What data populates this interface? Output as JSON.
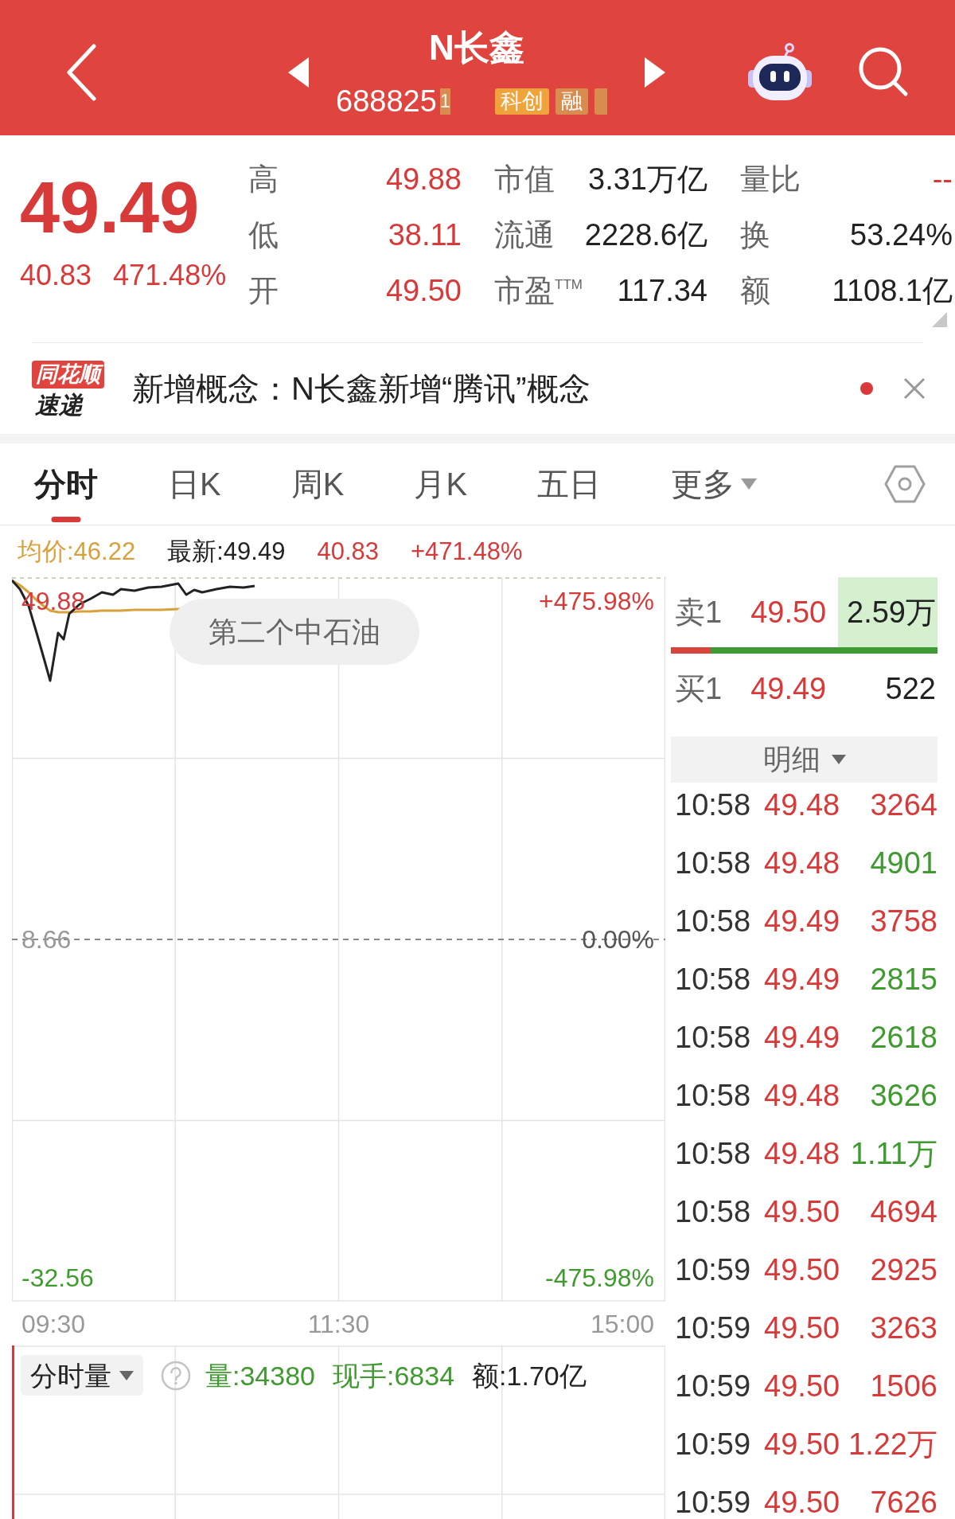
{
  "header": {
    "title": "N长鑫",
    "code": "688825",
    "tags": [
      {
        "kind": "partial",
        "text": "1",
        "color": "#d98c4f"
      },
      {
        "kind": "chip",
        "text": "科创",
        "color": "#f0a33b"
      },
      {
        "kind": "chip",
        "text": "融",
        "color": "#d98c4f"
      },
      {
        "kind": "clipped",
        "color": "#d98c4f"
      }
    ]
  },
  "quote": {
    "price": "49.49",
    "change": "40.83",
    "change_percent": "471.48%",
    "stat_rows": [
      {
        "cells": [
          {
            "label": "高",
            "value": "49.88",
            "color": "#d83a3a"
          },
          {
            "label": "市值",
            "value": "3.31万亿",
            "color": "#222222"
          },
          {
            "label": "量比",
            "value": "--",
            "color": "#d83a3a"
          }
        ]
      },
      {
        "cells": [
          {
            "label": "低",
            "value": "38.11",
            "color": "#d83a3a"
          },
          {
            "label": "流通",
            "value": "2228.6亿",
            "color": "#222222"
          },
          {
            "label": "换",
            "value": "53.24%",
            "color": "#222222"
          }
        ]
      },
      {
        "cells": [
          {
            "label": "开",
            "value": "49.50",
            "color": "#d83a3a"
          },
          {
            "label": "市盈$^{TTM}$",
            "value": "117.34",
            "color": "#222222"
          },
          {
            "label": "额",
            "value": "1108.1亿",
            "color": "#222222"
          }
        ]
      }
    ]
  },
  "news": {
    "logo_tag": "同花顺",
    "logo_text": "速递",
    "text": "新增概念：N长鑫新增“腾讯”概念",
    "unread": true
  },
  "tabs": [
    {
      "label": "分时",
      "selected": true,
      "dropdown": false
    },
    {
      "label": "日K",
      "selected": false,
      "dropdown": false
    },
    {
      "label": "周K",
      "selected": false,
      "dropdown": false
    },
    {
      "label": "月K",
      "selected": false,
      "dropdown": false
    },
    {
      "label": "五日",
      "selected": false,
      "dropdown": false
    },
    {
      "label": "更多",
      "selected": false,
      "dropdown": true
    }
  ],
  "chart": {
    "legend": [
      {
        "text": "均价:46.22",
        "color": "#d9a13c"
      },
      {
        "text": "最新:49.49",
        "color": "#222222"
      },
      {
        "text": "40.83",
        "color": "#d83a3a"
      },
      {
        "text": "+471.48%",
        "color": "#d83a3a"
      }
    ],
    "left_labels": [
      "49.88",
      "8.66",
      "-32.56"
    ],
    "right_labels": [
      "+475.98%",
      "0.00%",
      "-475.98%"
    ],
    "time_labels": [
      "09:30",
      "11:30",
      "15:00"
    ],
    "bubble": "第二个中石油"
  },
  "volume": {
    "selector": "分时量",
    "stats": [
      {
        "text": "量:34380",
        "color": "#3f9a2f"
      },
      {
        "text": "现手:6834",
        "color": "#3f9a2f"
      },
      {
        "text": "额:1.70亿",
        "color": "#222222"
      }
    ]
  },
  "order_book": {
    "ask": {
      "label": "卖1",
      "price": "49.50",
      "volume": "2.59万",
      "highlighted": true
    },
    "ratio": {
      "level": 0.15
    },
    "bid": {
      "label": "买1",
      "price": "49.49",
      "volume": "522",
      "highlighted": false
    }
  },
  "trades": {
    "header": "明细",
    "rows": [
      {
        "time": "10:58",
        "price": "49.48",
        "volume": "3264",
        "color": "#d83a3a"
      },
      {
        "time": "10:58",
        "price": "49.48",
        "volume": "4901",
        "color": "#3f9a2f"
      },
      {
        "time": "10:58",
        "price": "49.49",
        "volume": "3758",
        "color": "#d83a3a"
      },
      {
        "time": "10:58",
        "price": "49.49",
        "volume": "2815",
        "color": "#3f9a2f"
      },
      {
        "time": "10:58",
        "price": "49.49",
        "volume": "2618",
        "color": "#3f9a2f"
      },
      {
        "time": "10:58",
        "price": "49.48",
        "volume": "3626",
        "color": "#3f9a2f"
      },
      {
        "time": "10:58",
        "price": "49.48",
        "volume": "1.11万",
        "color": "#3f9a2f"
      },
      {
        "time": "10:58",
        "price": "49.50",
        "volume": "4694",
        "color": "#d83a3a"
      },
      {
        "time": "10:59",
        "price": "49.50",
        "volume": "2925",
        "color": "#d83a3a"
      },
      {
        "time": "10:59",
        "price": "49.50",
        "volume": "3263",
        "color": "#d83a3a"
      },
      {
        "time": "10:59",
        "price": "49.50",
        "volume": "1506",
        "color": "#d83a3a"
      },
      {
        "time": "10:59",
        "price": "49.50",
        "volume": "1.22万",
        "color": "#d83a3a"
      },
      {
        "time": "10:59",
        "price": "49.50",
        "volume": "7626",
        "color": "#d83a3a"
      }
    ]
  }
}
